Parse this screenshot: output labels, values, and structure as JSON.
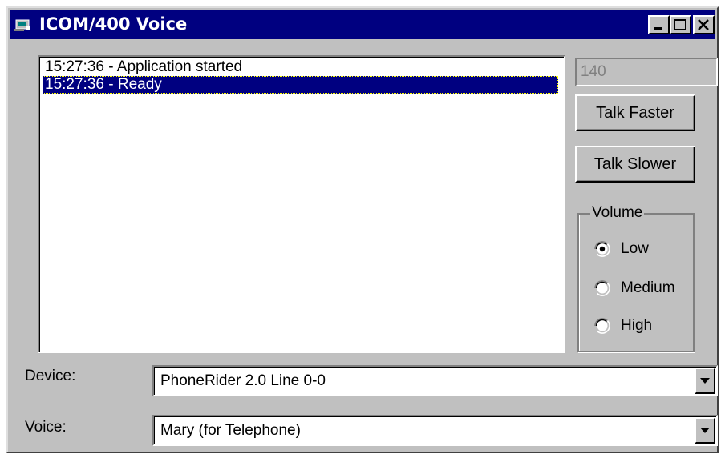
{
  "window": {
    "title": "ICOM/400 Voice",
    "controls": {
      "minimize_icon": "minimize-icon",
      "maximize_icon": "maximize-icon",
      "close_icon": "close-icon"
    }
  },
  "log": {
    "entries": [
      {
        "text": "15:27:36 - Application started",
        "selected": false
      },
      {
        "text": "15:27:36 - Ready",
        "selected": true
      }
    ]
  },
  "speech": {
    "rate_value": "140",
    "talk_faster_label": "Talk Faster",
    "talk_slower_label": "Talk Slower"
  },
  "volume": {
    "group_label": "Volume",
    "options": [
      {
        "label": "Low",
        "selected": true
      },
      {
        "label": "Medium",
        "selected": false
      },
      {
        "label": "High",
        "selected": false
      }
    ]
  },
  "device": {
    "label": "Device:",
    "value": "PhoneRider 2.0 Line 0-0"
  },
  "voice": {
    "label": "Voice:",
    "value": "Mary (for Telephone)"
  },
  "colors": {
    "face": "#c0c0c0",
    "titlebar": "#000080",
    "selection": "#000080"
  }
}
